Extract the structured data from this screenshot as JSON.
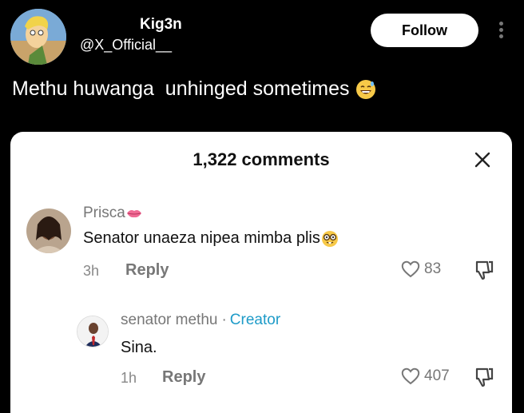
{
  "post": {
    "display_name": "Kig3n",
    "handle": "@X_Official__",
    "follow_label": "Follow",
    "text": "Methu huwanga  unhinged sometimes",
    "text_emoji": "grinning-sweat-emoji"
  },
  "comments_panel": {
    "title": "1,322 comments",
    "close_icon": "close-icon",
    "comments": [
      {
        "author": "Prisca",
        "author_emoji": "lips-emoji",
        "text": "Senator unaeza nipea mimba plis",
        "text_emoji": "nerd-face-emoji",
        "time": "3h",
        "reply_label": "Reply",
        "likes": "83"
      },
      {
        "author": "senator methu",
        "separator": "·",
        "badge": "Creator",
        "text": "Sina.",
        "time": "1h",
        "reply_label": "Reply",
        "likes": "407"
      }
    ]
  },
  "colors": {
    "background": "#000000",
    "card": "#ffffff",
    "creator_accent": "#1e9bc8",
    "muted": "#777777"
  }
}
